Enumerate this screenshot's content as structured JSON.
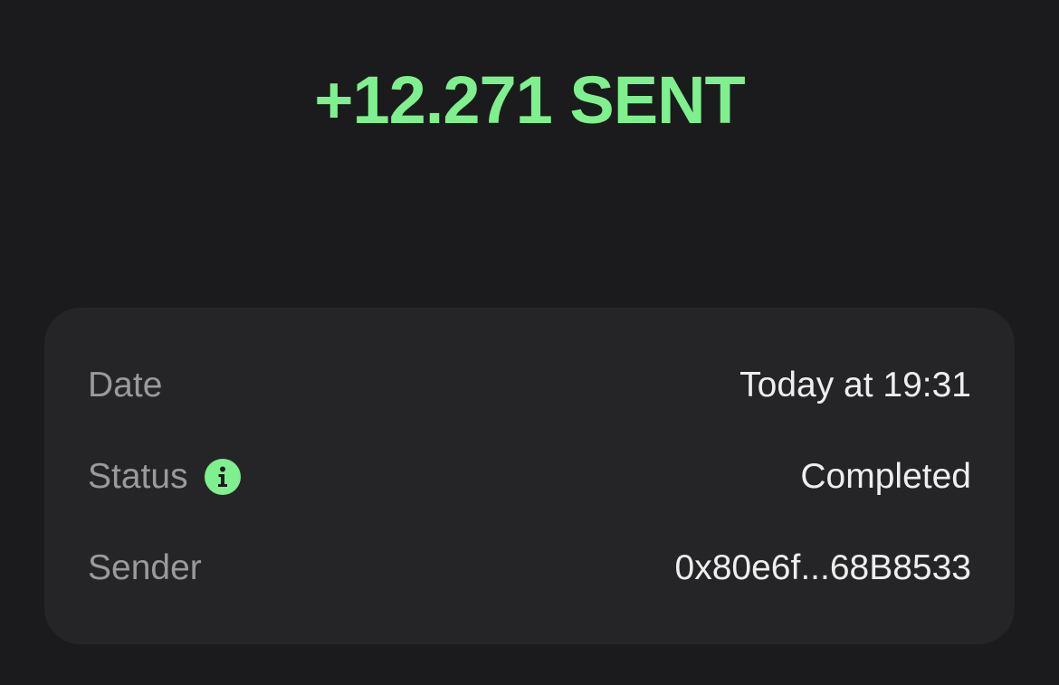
{
  "transaction": {
    "amount": "+12.271 SENT"
  },
  "details": {
    "date": {
      "label": "Date",
      "value": "Today at 19:31"
    },
    "status": {
      "label": "Status",
      "value": "Completed",
      "icon": "info-icon"
    },
    "sender": {
      "label": "Sender",
      "value": "0x80e6f...68B8533"
    }
  },
  "colors": {
    "accent": "#7ef08d",
    "background": "#1b1b1d",
    "card": "#252527",
    "label_text": "#9a9a9e",
    "value_text": "#eeeeee"
  }
}
